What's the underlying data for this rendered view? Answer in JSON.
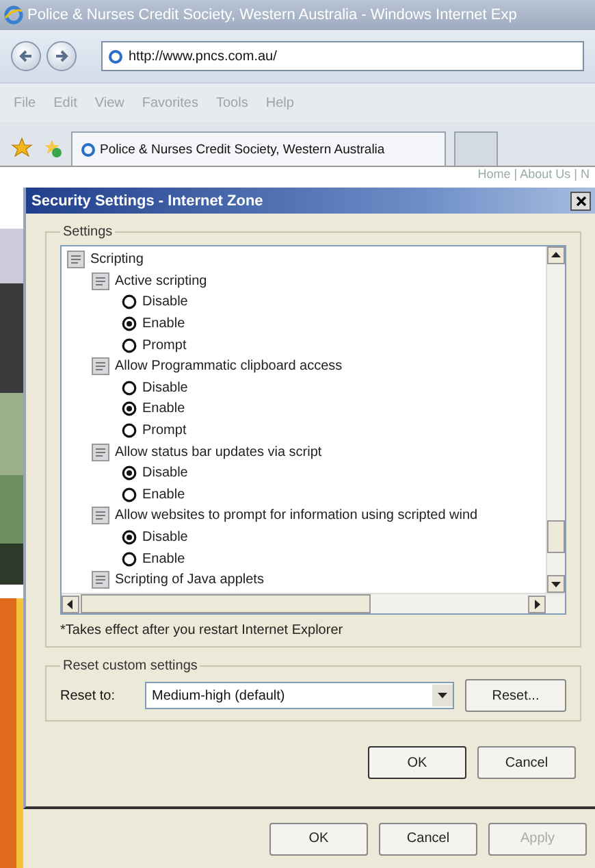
{
  "browser": {
    "title": "Police & Nurses Credit Society, Western Australia - Windows Internet Exp",
    "address": "http://www.pncs.com.au/",
    "menu": [
      "File",
      "Edit",
      "View",
      "Favorites",
      "Tools",
      "Help"
    ],
    "tabs": [
      {
        "label": "Police & Nurses Credit Society, Western Australia",
        "selected": true
      }
    ],
    "page_nav": "Home | About Us | N"
  },
  "dialog": {
    "title": "Security Settings - Internet Zone",
    "settings_label": "Settings",
    "tree": [
      {
        "kind": "group",
        "label": "Scripting",
        "children": [
          {
            "kind": "setting",
            "label": "Active scripting",
            "children": [
              {
                "kind": "option",
                "label": "Disable",
                "selected": false
              },
              {
                "kind": "option",
                "label": "Enable",
                "selected": true
              },
              {
                "kind": "option",
                "label": "Prompt",
                "selected": false
              }
            ]
          },
          {
            "kind": "setting",
            "label": "Allow Programmatic clipboard access",
            "children": [
              {
                "kind": "option",
                "label": "Disable",
                "selected": false
              },
              {
                "kind": "option",
                "label": "Enable",
                "selected": true
              },
              {
                "kind": "option",
                "label": "Prompt",
                "selected": false
              }
            ]
          },
          {
            "kind": "setting",
            "label": "Allow status bar updates via script",
            "children": [
              {
                "kind": "option",
                "label": "Disable",
                "selected": true
              },
              {
                "kind": "option",
                "label": "Enable",
                "selected": false
              }
            ]
          },
          {
            "kind": "setting",
            "label": "Allow websites to prompt for information using scripted wind",
            "children": [
              {
                "kind": "option",
                "label": "Disable",
                "selected": true
              },
              {
                "kind": "option",
                "label": "Enable",
                "selected": false
              }
            ]
          },
          {
            "kind": "setting",
            "label": "Scripting of Java applets"
          }
        ]
      }
    ],
    "note": "*Takes effect after you restart Internet Explorer",
    "reset_group": "Reset custom settings",
    "reset_label": "Reset to:",
    "reset_value": "Medium-high (default)",
    "reset_button": "Reset...",
    "buttons": [
      "OK",
      "Cancel"
    ]
  },
  "outer_buttons": [
    {
      "label": "OK",
      "disabled": false
    },
    {
      "label": "Cancel",
      "disabled": false
    },
    {
      "label": "Apply",
      "disabled": true
    }
  ]
}
